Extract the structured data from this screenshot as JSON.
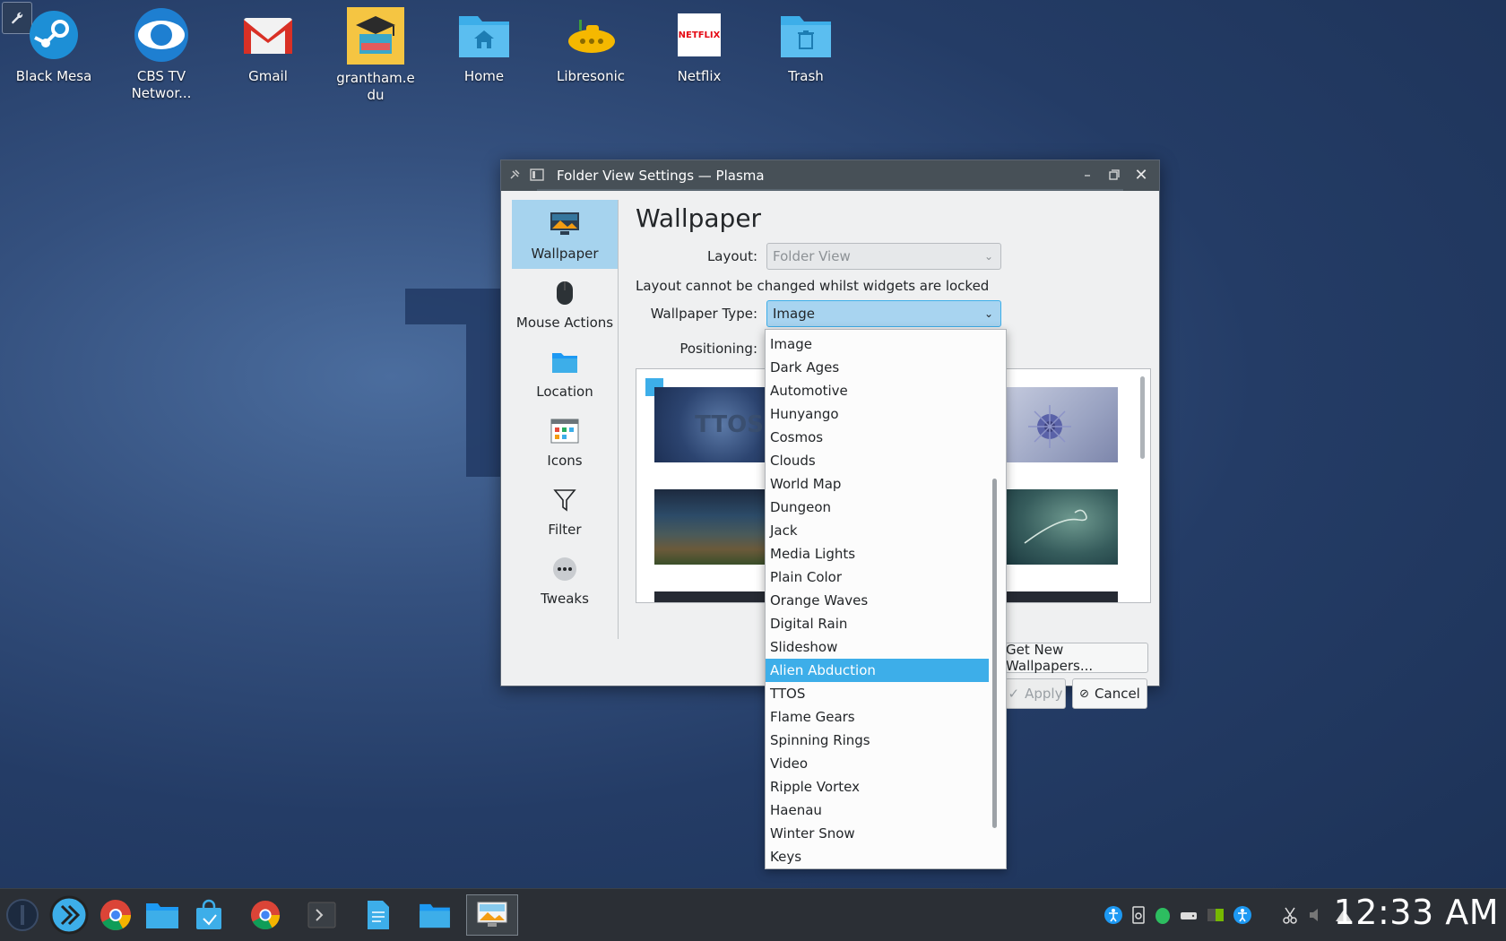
{
  "desktop": {
    "icons": [
      {
        "name": "steam",
        "label": "Black Mesa"
      },
      {
        "name": "cbs",
        "label": "CBS TV Networ..."
      },
      {
        "name": "gmail",
        "label": "Gmail"
      },
      {
        "name": "grantham",
        "label": "grantham.edu"
      },
      {
        "name": "home",
        "label": "Home"
      },
      {
        "name": "libresonic",
        "label": "Libresonic"
      },
      {
        "name": "netflix",
        "label": "Netflix",
        "logo_text": "NETFLIX"
      },
      {
        "name": "trash",
        "label": "Trash"
      }
    ]
  },
  "window": {
    "title": "Folder View Settings — Plasma",
    "sidebar": [
      {
        "id": "wallpaper",
        "label": "Wallpaper",
        "selected": true
      },
      {
        "id": "mouse",
        "label": "Mouse Actions"
      },
      {
        "id": "location",
        "label": "Location"
      },
      {
        "id": "icons",
        "label": "Icons"
      },
      {
        "id": "filter",
        "label": "Filter"
      },
      {
        "id": "tweaks",
        "label": "Tweaks"
      }
    ],
    "page_title": "Wallpaper",
    "layout_label": "Layout:",
    "layout_value": "Folder View",
    "locked_note": "Layout cannot be changed whilst widgets are locked",
    "wallpaper_type_label": "Wallpaper Type:",
    "wallpaper_type_value": "Image",
    "positioning_label": "Positioning:",
    "thumb_ttos_text": "TTOS",
    "get_new_label": "Get New Wallpapers...",
    "apply_label": "Apply",
    "cancel_label": "Cancel"
  },
  "dropdown": {
    "items": [
      "Image",
      "Dark Ages",
      "Automotive",
      "Hunyango",
      "Cosmos",
      "Clouds",
      "World Map",
      "Dungeon",
      "Jack",
      "Media Lights",
      "Plain Color",
      "Orange Waves",
      "Digital Rain",
      "Slideshow",
      "Alien Abduction",
      "TTOS",
      "Flame Gears",
      "Spinning Rings",
      "Video",
      "Ripple Vortex",
      "Haenau",
      "Winter Snow",
      "Keys"
    ],
    "highlighted": "Alien Abduction"
  },
  "taskbar": {
    "clock": "12:33 AM"
  },
  "colors": {
    "accent": "#3daee9",
    "selection_bg": "#a6d3ee",
    "titlebar": "#475057",
    "taskbar": "#2b2f35"
  }
}
